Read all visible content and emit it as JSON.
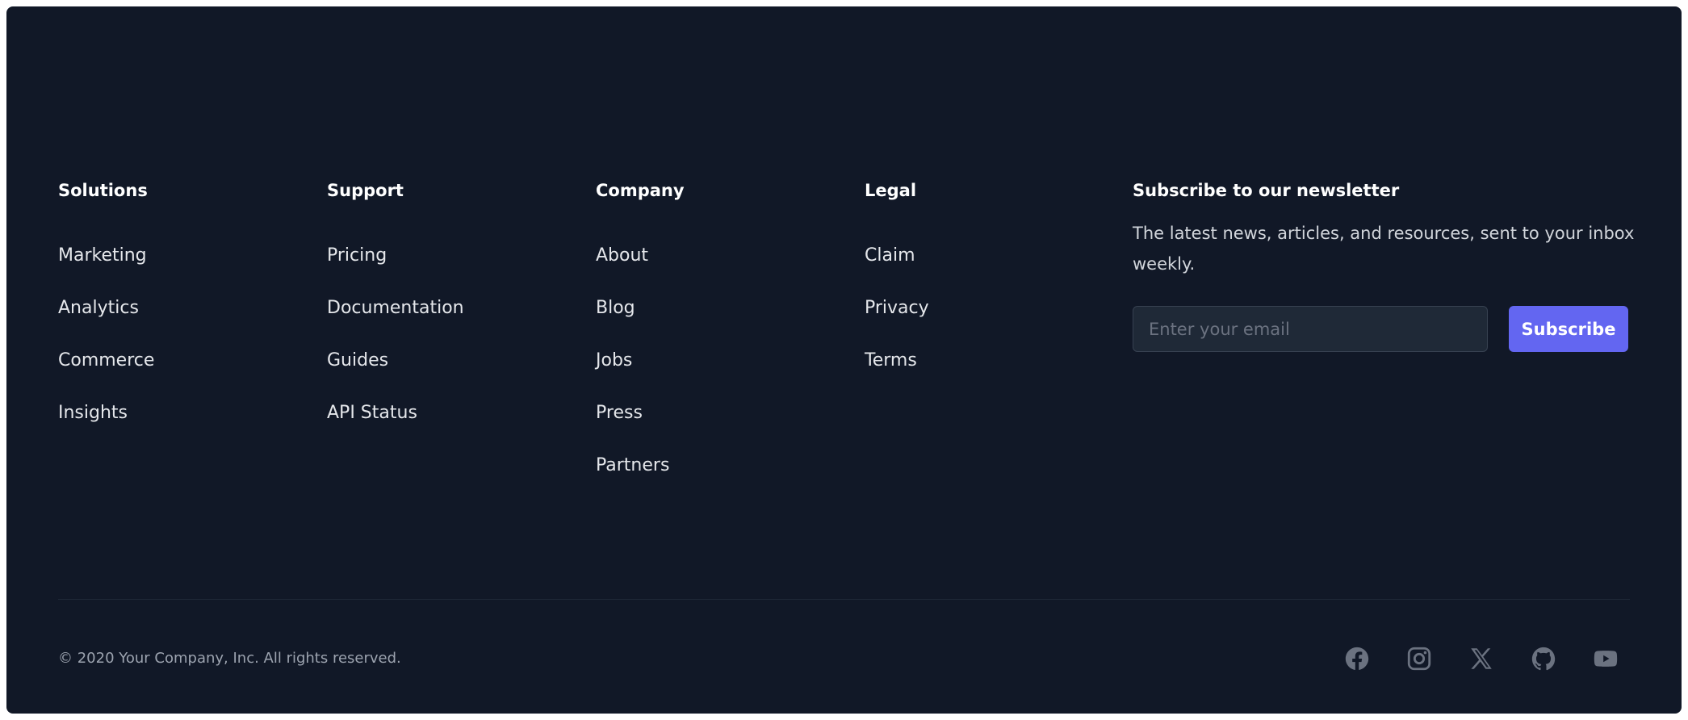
{
  "columns": [
    {
      "heading": "Solutions",
      "links": [
        "Marketing",
        "Analytics",
        "Commerce",
        "Insights"
      ]
    },
    {
      "heading": "Support",
      "links": [
        "Pricing",
        "Documentation",
        "Guides",
        "API Status"
      ]
    },
    {
      "heading": "Company",
      "links": [
        "About",
        "Blog",
        "Jobs",
        "Press",
        "Partners"
      ]
    },
    {
      "heading": "Legal",
      "links": [
        "Claim",
        "Privacy",
        "Terms"
      ]
    }
  ],
  "newsletter": {
    "heading": "Subscribe to our newsletter",
    "description": "The latest news, articles, and resources, sent to your inbox weekly.",
    "email_placeholder": "Enter your email",
    "button_label": "Subscribe"
  },
  "copyright": "© 2020 Your Company, Inc. All rights reserved.",
  "socials": [
    "facebook-icon",
    "instagram-icon",
    "x-icon",
    "github-icon",
    "youtube-icon"
  ],
  "colors": {
    "background": "#111827",
    "accent": "#6366f1",
    "icon": "#6b7280"
  }
}
